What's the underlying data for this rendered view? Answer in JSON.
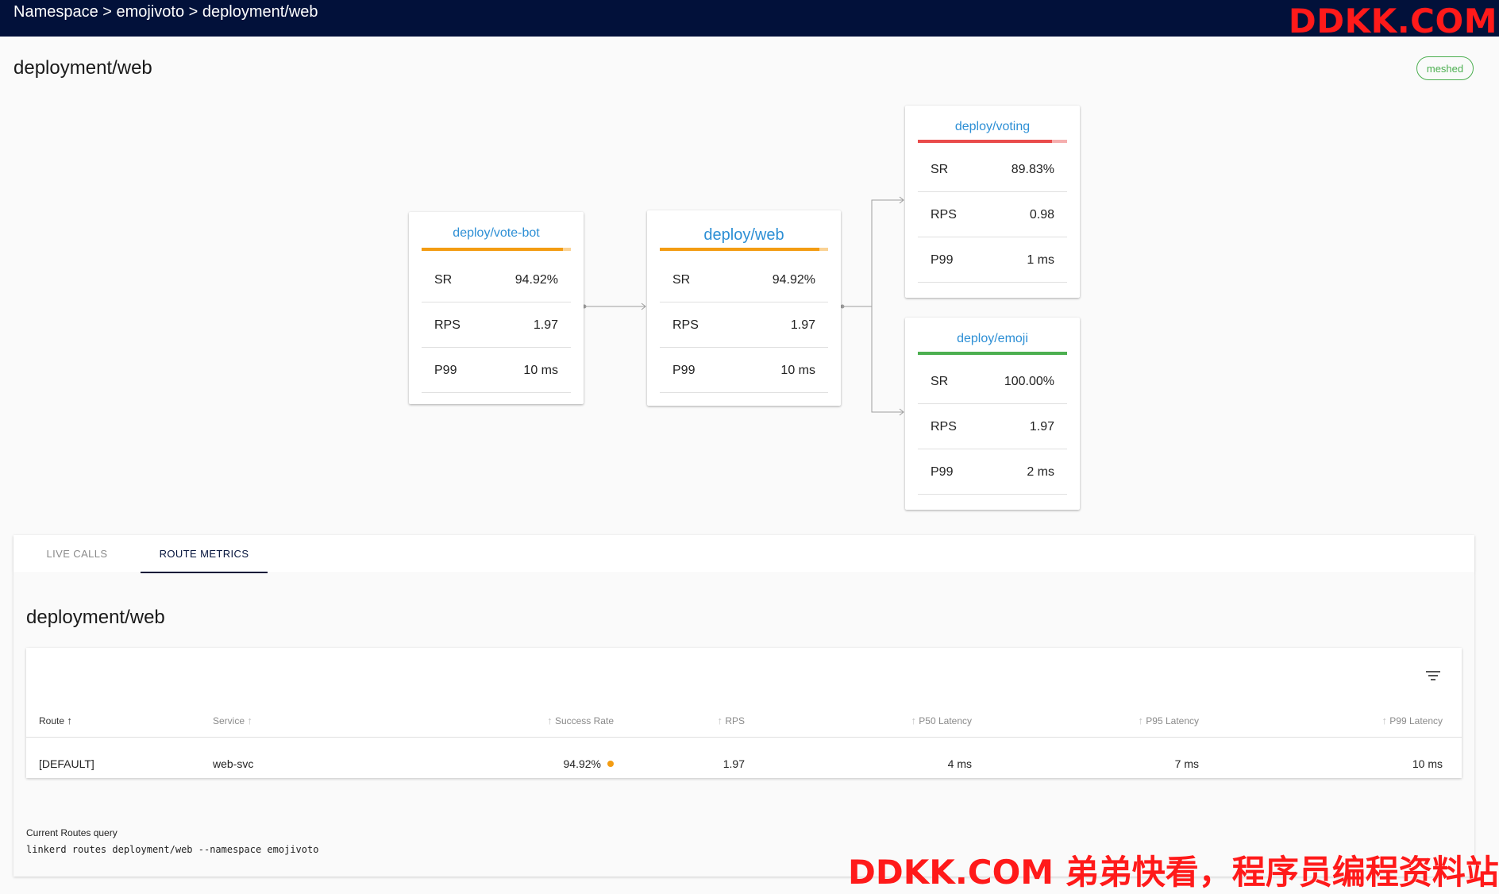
{
  "header": {
    "breadcrumb": "Namespace > emojivoto > deployment/web"
  },
  "watermark": {
    "top": "DDKK.COM",
    "bottom": "DDKK.COM 弟弟快看，程序员编程资料站"
  },
  "page": {
    "title": "deployment/web",
    "badge": "meshed"
  },
  "colors": {
    "navy": "#02113a",
    "link_blue": "#2d8fd5",
    "orange": "#f39c12",
    "red": "#e94b4b",
    "green": "#4caf50"
  },
  "nodes": {
    "vote_bot": {
      "name": "deploy/vote-bot",
      "sr_fraction": 0.9492,
      "stats": [
        {
          "k": "SR",
          "v": "94.92%"
        },
        {
          "k": "RPS",
          "v": "1.97"
        },
        {
          "k": "P99",
          "v": "10 ms"
        }
      ]
    },
    "web": {
      "name": "deploy/web",
      "sr_fraction": 0.9492,
      "stats": [
        {
          "k": "SR",
          "v": "94.92%"
        },
        {
          "k": "RPS",
          "v": "1.97"
        },
        {
          "k": "P99",
          "v": "10 ms"
        }
      ]
    },
    "voting": {
      "name": "deploy/voting",
      "sr_fraction": 0.8983,
      "stats": [
        {
          "k": "SR",
          "v": "89.83%"
        },
        {
          "k": "RPS",
          "v": "0.98"
        },
        {
          "k": "P99",
          "v": "1 ms"
        }
      ]
    },
    "emoji": {
      "name": "deploy/emoji",
      "sr_fraction": 1.0,
      "stats": [
        {
          "k": "SR",
          "v": "100.00%"
        },
        {
          "k": "RPS",
          "v": "1.97"
        },
        {
          "k": "P99",
          "v": "2 ms"
        }
      ]
    }
  },
  "tabs": {
    "live_calls": "LIVE CALLS",
    "route_metrics": "ROUTE METRICS"
  },
  "route_metrics": {
    "title": "deployment/web",
    "filter_icon": "filter-list-icon",
    "columns": [
      "Route",
      "Service",
      "Success Rate",
      "RPS",
      "P50 Latency",
      "P95 Latency",
      "P99 Latency"
    ],
    "rows": [
      {
        "route": "[DEFAULT]",
        "service": "web-svc",
        "success_rate": "94.92%",
        "rps": "1.97",
        "p50": "4 ms",
        "p95": "7 ms",
        "p99": "10 ms"
      }
    ],
    "query_label": "Current Routes query",
    "query": "linkerd routes deployment/web --namespace emojivoto"
  }
}
